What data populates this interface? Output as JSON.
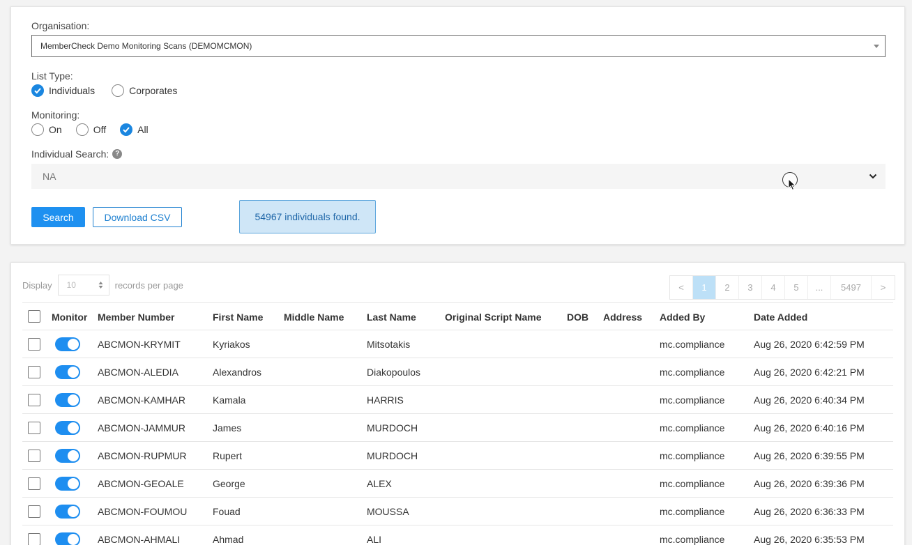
{
  "filters": {
    "organisation_label": "Organisation:",
    "organisation_value": "MemberCheck Demo Monitoring Scans (DEMOMCMON)",
    "list_type_label": "List Type:",
    "list_type_options": [
      "Individuals",
      "Corporates"
    ],
    "list_type_selected": "Individuals",
    "monitoring_label": "Monitoring:",
    "monitoring_options": [
      "On",
      "Off",
      "All"
    ],
    "monitoring_selected": "All",
    "individual_search_label": "Individual Search:",
    "individual_search_value": "NA",
    "search_button": "Search",
    "download_button": "Download CSV",
    "result_message": "54967 individuals found."
  },
  "results": {
    "display_label": "Display",
    "per_page_value": "10",
    "per_page_suffix": "records per page",
    "pagination": [
      "<",
      "1",
      "2",
      "3",
      "4",
      "5",
      "...",
      "5497",
      ">"
    ],
    "current_page": "1",
    "columns": [
      "Monitor",
      "Member Number",
      "First Name",
      "Middle Name",
      "Last Name",
      "Original Script Name",
      "DOB",
      "Address",
      "Added By",
      "Date Added"
    ],
    "rows": [
      {
        "member": "ABCMON-KRYMIT",
        "first": "Kyriakos",
        "middle": "",
        "last": "Mitsotakis",
        "script": "",
        "dob": "",
        "address": "",
        "added_by": "mc.compliance",
        "date": "Aug 26, 2020 6:42:59 PM"
      },
      {
        "member": "ABCMON-ALEDIA",
        "first": "Alexandros",
        "middle": "",
        "last": "Diakopoulos",
        "script": "",
        "dob": "",
        "address": "",
        "added_by": "mc.compliance",
        "date": "Aug 26, 2020 6:42:21 PM"
      },
      {
        "member": "ABCMON-KAMHAR",
        "first": "Kamala",
        "middle": "",
        "last": "HARRIS",
        "script": "",
        "dob": "",
        "address": "",
        "added_by": "mc.compliance",
        "date": "Aug 26, 2020 6:40:34 PM"
      },
      {
        "member": "ABCMON-JAMMUR",
        "first": "James",
        "middle": "",
        "last": "MURDOCH",
        "script": "",
        "dob": "",
        "address": "",
        "added_by": "mc.compliance",
        "date": "Aug 26, 2020 6:40:16 PM"
      },
      {
        "member": "ABCMON-RUPMUR",
        "first": "Rupert",
        "middle": "",
        "last": "MURDOCH",
        "script": "",
        "dob": "",
        "address": "",
        "added_by": "mc.compliance",
        "date": "Aug 26, 2020 6:39:55 PM"
      },
      {
        "member": "ABCMON-GEOALE",
        "first": "George",
        "middle": "",
        "last": "ALEX",
        "script": "",
        "dob": "",
        "address": "",
        "added_by": "mc.compliance",
        "date": "Aug 26, 2020 6:39:36 PM"
      },
      {
        "member": "ABCMON-FOUMOU",
        "first": "Fouad",
        "middle": "",
        "last": "MOUSSA",
        "script": "",
        "dob": "",
        "address": "",
        "added_by": "mc.compliance",
        "date": "Aug 26, 2020 6:36:33 PM"
      },
      {
        "member": "ABCMON-AHMALI",
        "first": "Ahmad",
        "middle": "",
        "last": "ALI",
        "script": "",
        "dob": "",
        "address": "",
        "added_by": "mc.compliance",
        "date": "Aug 26, 2020 6:35:53 PM"
      }
    ]
  },
  "colors": {
    "accent": "#1e90f0",
    "alert_bg": "#cfe6f7",
    "alert_text": "#1e66a8"
  }
}
